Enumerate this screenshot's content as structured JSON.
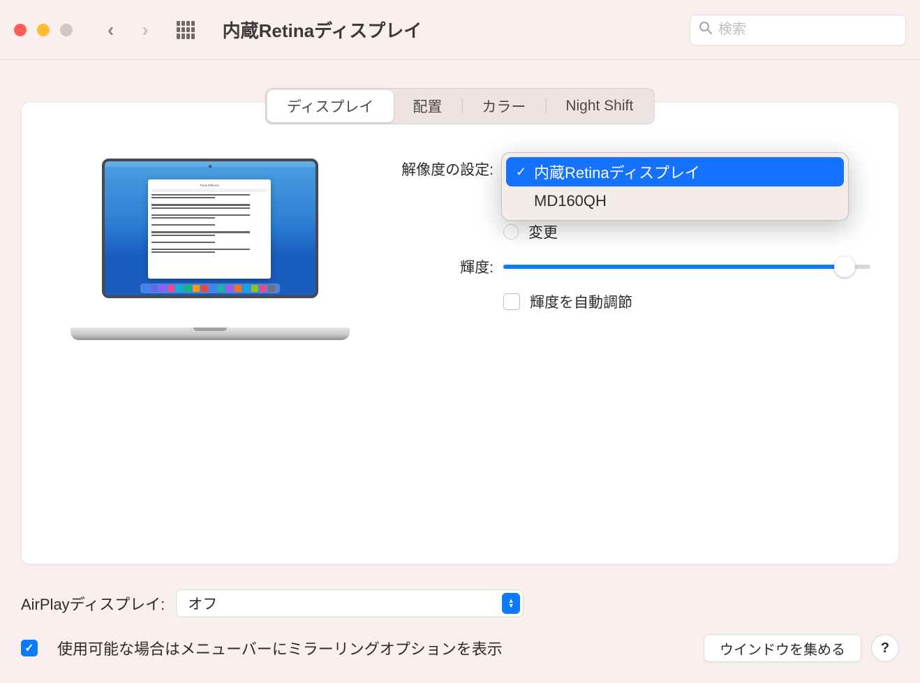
{
  "window": {
    "title": "内蔵Retinaディスプレイ"
  },
  "search": {
    "placeholder": "検索"
  },
  "tabs": {
    "display": "ディスプレイ",
    "arrangement": "配置",
    "color": "カラー",
    "night_shift": "Night Shift"
  },
  "controls": {
    "resolution_label": "解像度の設定:",
    "resolution_change": "変更",
    "brightness_label": "輝度:",
    "auto_brightness": "輝度を自動調節"
  },
  "dropdown": {
    "options": [
      "内蔵Retinaディスプレイ",
      "MD160QH"
    ],
    "selected": "内蔵Retinaディスプレイ"
  },
  "airplay": {
    "label": "AirPlayディスプレイ:",
    "value": "オフ"
  },
  "footer": {
    "mirror_checkbox": "使用可能な場合はメニューバーにミラーリングオプションを表示",
    "gather_windows": "ウインドウを集める",
    "help": "?"
  },
  "laptop_doc": {
    "title": "Think Different"
  },
  "colors": {
    "accent": "#0a7aff"
  }
}
